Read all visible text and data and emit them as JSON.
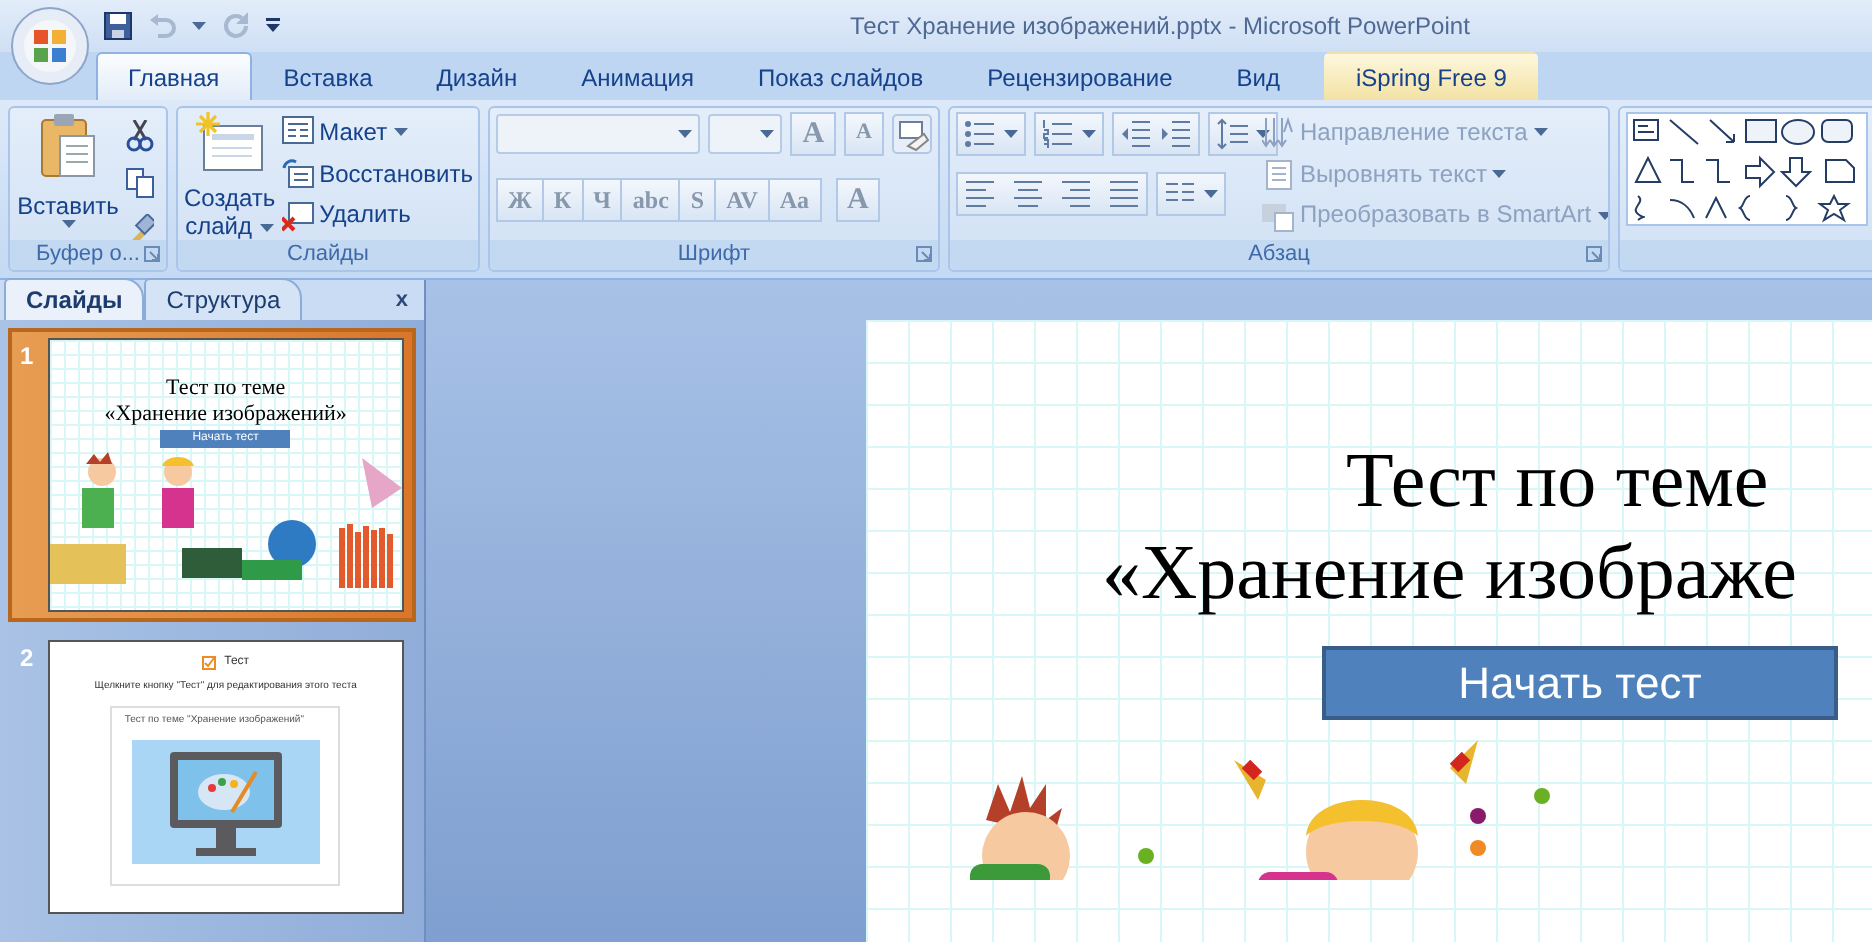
{
  "window": {
    "title": "Тест Хранение изображений.pptx - Microsoft PowerPoint"
  },
  "tabs": [
    {
      "label": "Главная",
      "selected": true,
      "kind": "standard"
    },
    {
      "label": "Вставка",
      "selected": false,
      "kind": "standard"
    },
    {
      "label": "Дизайн",
      "selected": false,
      "kind": "standard"
    },
    {
      "label": "Анимация",
      "selected": false,
      "kind": "standard"
    },
    {
      "label": "Показ слайдов",
      "selected": false,
      "kind": "standard"
    },
    {
      "label": "Рецензирование",
      "selected": false,
      "kind": "standard"
    },
    {
      "label": "Вид",
      "selected": false,
      "kind": "standard"
    },
    {
      "label": "iSpring Free 9",
      "selected": false,
      "kind": "addin"
    }
  ],
  "ribbon": {
    "groups": [
      {
        "kind": "clipboard",
        "label": "Буфер о...",
        "paste": "Вставить"
      },
      {
        "kind": "slides",
        "label": "Слайды",
        "new_slide": [
          "Создать",
          "слайд"
        ],
        "commands": [
          {
            "label": "Макет",
            "disabled": false,
            "kind": "layout"
          },
          {
            "label": "Восстановить",
            "disabled": false,
            "kind": "reset"
          },
          {
            "label": "Удалить",
            "disabled": false,
            "kind": "delete"
          }
        ]
      },
      {
        "kind": "font",
        "label": "Шрифт",
        "grow": "A",
        "shrink": "A",
        "buttons": [
          "Ж",
          "К",
          "Ч",
          "abc",
          "S",
          "AV",
          "Aa"
        ],
        "color_button": "A",
        "disabled": true
      },
      {
        "kind": "paragraph",
        "label": "Абзац",
        "commands": [
          {
            "label": "Направление текста",
            "disabled": true,
            "kind": "direction"
          },
          {
            "label": "Выровнять текст",
            "disabled": true,
            "kind": "align"
          },
          {
            "label": "Преобразовать в SmartArt",
            "disabled": true,
            "kind": "smartart"
          }
        ]
      },
      {
        "kind": "drawing"
      }
    ]
  },
  "pane": {
    "tabs": [
      {
        "label": "Слайды",
        "selected": true
      },
      {
        "label": "Структура",
        "selected": false
      }
    ],
    "close": "x",
    "slides": [
      {
        "number": "1",
        "selected": true,
        "kind": "title",
        "title_lines": [
          "Тест по теме",
          "«Хранение изображений»"
        ],
        "button": "Начать тест"
      },
      {
        "number": "2",
        "selected": false,
        "kind": "quiz",
        "heading": "Тест",
        "instruction": "Щелкните кнопку \"Тест\" для редактирования этого теста",
        "quiz_title": "Тест по теме \"Хранение изображений\""
      }
    ]
  },
  "slide": {
    "title_lines": [
      "Тест по теме",
      "«Хранение изображе"
    ],
    "button": "Начать тест"
  }
}
